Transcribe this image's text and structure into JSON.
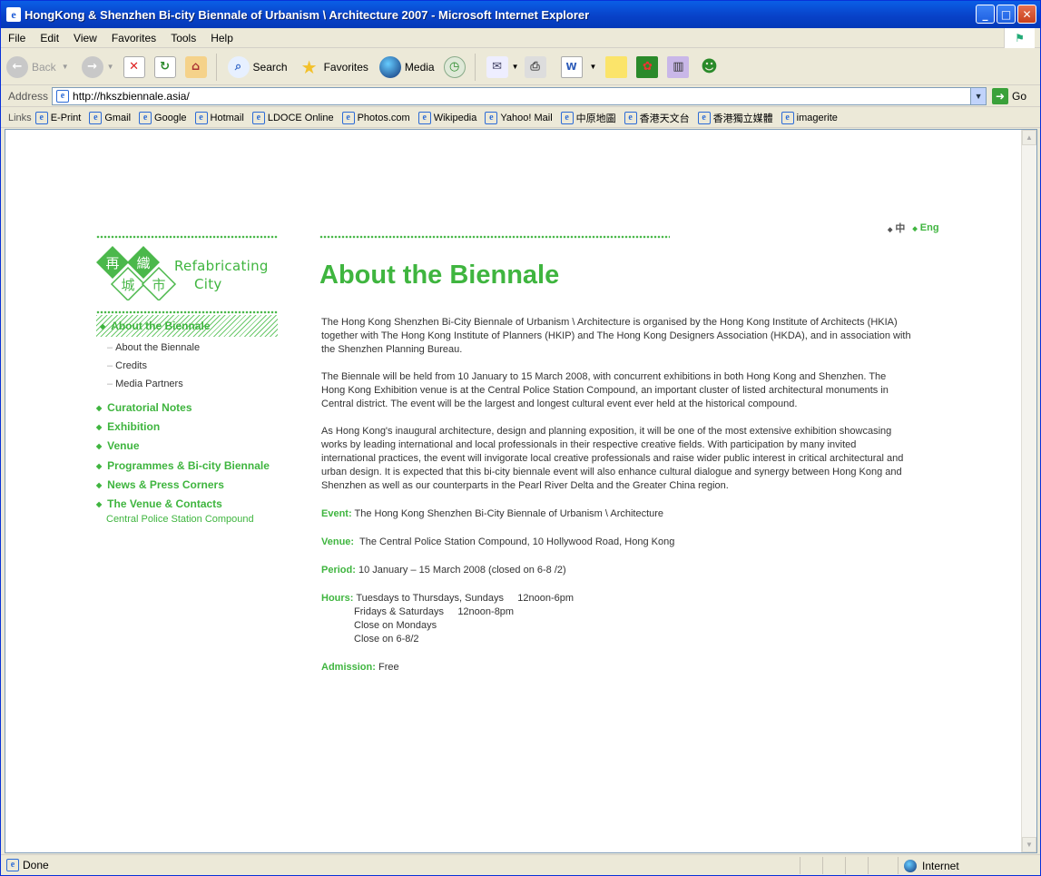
{
  "window": {
    "title": "HongKong & Shenzhen Bi-city Biennale of Urbanism \\ Architecture 2007 - Microsoft Internet Explorer"
  },
  "menu": [
    "File",
    "Edit",
    "View",
    "Favorites",
    "Tools",
    "Help"
  ],
  "toolbar": {
    "back": "Back",
    "search": "Search",
    "favorites": "Favorites",
    "media": "Media"
  },
  "address": {
    "label": "Address",
    "url": "http://hkszbiennale.asia/",
    "go": "Go"
  },
  "links": {
    "label": "Links",
    "items": [
      "E-Print",
      "Gmail",
      "Google",
      "Hotmail",
      "LDOCE Online",
      "Photos.com",
      "Wikipedia",
      "Yahoo! Mail",
      "中原地圖",
      "香港天文台",
      "香港獨立媒體",
      "imagerite"
    ]
  },
  "status": {
    "text": "Done",
    "zone": "Internet"
  },
  "page": {
    "lang": {
      "zh": "中",
      "en": "Eng"
    },
    "logo": {
      "line1": "Refabricating",
      "line2": "City",
      "glyphs": [
        "再",
        "織",
        "城",
        "市"
      ]
    },
    "nav": {
      "active": "About the Biennale",
      "sub": [
        "About the Biennale",
        "Credits",
        "Media Partners"
      ],
      "items": [
        "Curatorial Notes",
        "Exhibition",
        "Venue",
        "Programmes & Bi-city Biennale",
        "News & Press Corners",
        "The Venue & Contacts"
      ],
      "venue_sub": "Central Police Station Compound"
    },
    "heading": "About the Biennale",
    "paragraphs": [
      "The Hong Kong Shenzhen Bi-City Biennale of Urbanism \\ Architecture is organised by the Hong Kong Institute of Architects (HKIA) together with The Hong Kong Institute of Planners (HKIP) and The Hong Kong Designers Association (HKDA), and in association with the Shenzhen Planning Bureau.",
      "The Biennale will be held from 10 January to 15 March 2008, with concurrent exhibitions in both Hong Kong and Shenzhen. The Hong Kong Exhibition venue is at the Central Police Station Compound, an important cluster of listed architectural monuments in Central district. The event will be the largest and longest cultural event ever held at the historical compound.",
      "As Hong Kong's inaugural architecture, design and planning exposition, it will be one of the most extensive exhibition showcasing works by leading international and local professionals in their respective creative fields. With participation by many invited international practices, the event will invigorate local creative professionals and raise wider public interest in critical architectural and urban design. It is expected that this bi-city biennale event will also enhance cultural dialogue and synergy between Hong Kong and Shenzhen as well as our counterparts in the Pearl River Delta and the Greater China region."
    ],
    "details": {
      "event_label": "Event:",
      "event": "The Hong Kong Shenzhen Bi-City Biennale of Urbanism \\ Architecture",
      "venue_label": "Venue:",
      "venue": "The Central Police Station Compound, 10 Hollywood Road, Hong Kong",
      "period_label": "Period:",
      "period": "10 January – 15 March 2008 (closed on 6-8 /2)",
      "hours_label": "Hours:",
      "hours_1": "Tuesdays to Thursdays, Sundays     12noon-6pm",
      "hours_2": "Fridays & Saturdays     12noon-8pm",
      "hours_3": "Close on Mondays",
      "hours_4": "Close on 6-8/2",
      "admission_label": "Admission:",
      "admission": "Free"
    }
  }
}
